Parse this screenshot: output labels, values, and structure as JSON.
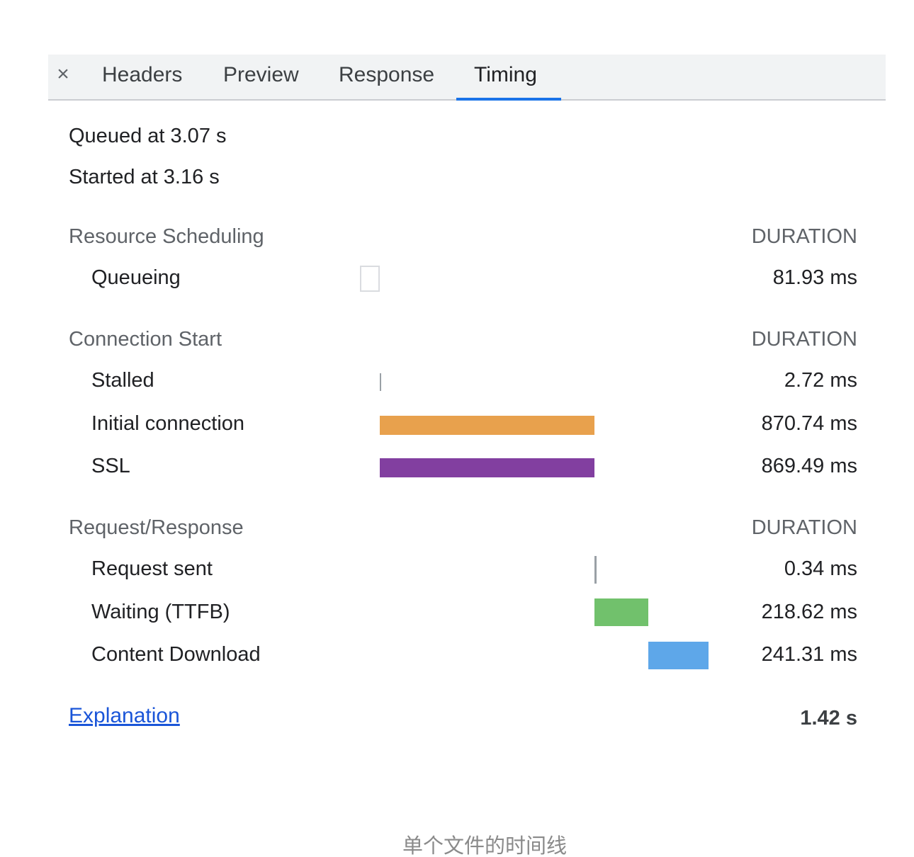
{
  "tabs": {
    "close_glyph": "×",
    "items": [
      "Headers",
      "Preview",
      "Response",
      "Timing"
    ],
    "active": "Timing"
  },
  "info": {
    "queued": "Queued at 3.07 s",
    "started": "Started at 3.16 s"
  },
  "sections": [
    {
      "title": "Resource Scheduling",
      "duration_label": "DURATION",
      "rows": [
        {
          "label": "Queueing",
          "value": "81.93 ms"
        }
      ]
    },
    {
      "title": "Connection Start",
      "duration_label": "DURATION",
      "rows": [
        {
          "label": "Stalled",
          "value": "2.72 ms"
        },
        {
          "label": "Initial connection",
          "value": "870.74 ms"
        },
        {
          "label": "SSL",
          "value": "869.49 ms"
        }
      ]
    },
    {
      "title": "Request/Response",
      "duration_label": "DURATION",
      "rows": [
        {
          "label": "Request sent",
          "value": "0.34 ms"
        },
        {
          "label": "Waiting (TTFB)",
          "value": "218.62 ms"
        },
        {
          "label": "Content Download",
          "value": "241.31 ms"
        }
      ]
    }
  ],
  "footer": {
    "explanation_link": "Explanation",
    "total": "1.42 s"
  },
  "caption": "单个文件的时间线",
  "colors": {
    "active_tab": "#1a73e8",
    "initial_connection": "#e8a14d",
    "ssl": "#823fa0",
    "waiting": "#71c16c",
    "content_download": "#5ea7e9"
  }
}
